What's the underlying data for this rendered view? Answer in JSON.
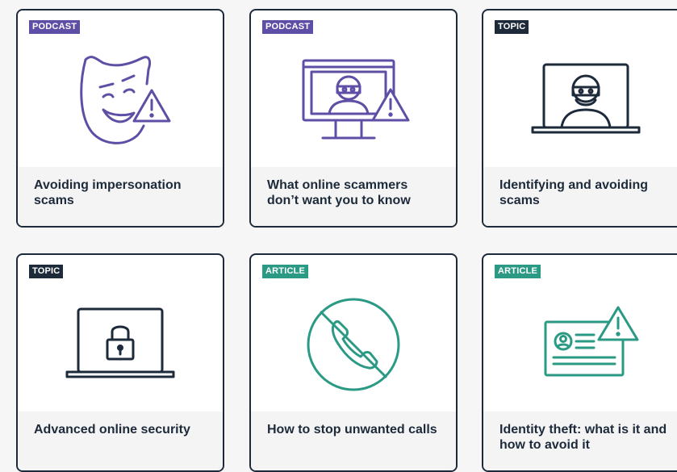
{
  "colors": {
    "navy": "#1d2a3a",
    "purple": "#5f4ea6",
    "teal": "#2a9a84",
    "card_footer": "#f4f4f5"
  },
  "cards": [
    {
      "badge": "PODCAST",
      "badge_color": "purple",
      "icon": "comedy-mask-warning-icon",
      "title": "Avoiding impersonation scams"
    },
    {
      "badge": "PODCAST",
      "badge_color": "purple",
      "icon": "monitor-scammer-warning-icon",
      "title": "What online scammers don’t want you to know"
    },
    {
      "badge": "TOPIC",
      "badge_color": "navy",
      "icon": "laptop-scammer-icon",
      "title": "Identifying and avoiding scams"
    },
    {
      "badge": "TOPIC",
      "badge_color": "navy",
      "icon": "laptop-lock-icon",
      "title": "Advanced online security"
    },
    {
      "badge": "ARTICLE",
      "badge_color": "teal",
      "icon": "blocked-phone-icon",
      "title": "How to stop unwanted calls"
    },
    {
      "badge": "ARTICLE",
      "badge_color": "teal",
      "icon": "id-card-warning-icon",
      "title": "Identity theft: what is it and how to avoid it"
    }
  ]
}
